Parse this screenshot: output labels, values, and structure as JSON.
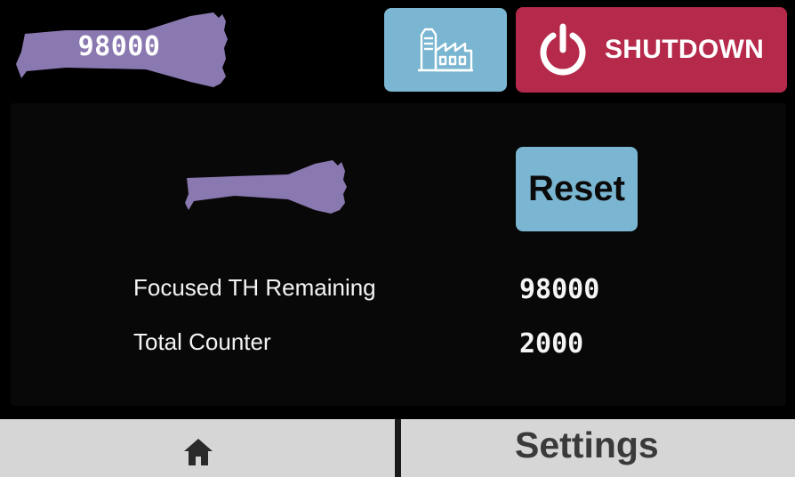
{
  "header": {
    "handpiece_counter": "98000",
    "factory_icon": "factory-icon",
    "shutdown_icon": "power-icon",
    "shutdown_label": "SHUTDOWN"
  },
  "main": {
    "handpiece_icon": "handpiece-icon",
    "reset_label": "Reset",
    "rows": [
      {
        "label": "Focused TH Remaining",
        "value": "98000"
      },
      {
        "label": "Total Counter",
        "value": "2000"
      }
    ]
  },
  "nav": {
    "home_icon": "home-icon",
    "settings_label": "Settings"
  },
  "colors": {
    "background": "#000000",
    "panel": "#080808",
    "handpiece": "#8a78b0",
    "button_blue": "#7ab6d1",
    "shutdown_red": "#b5294a",
    "nav_bar": "#d6d6d6"
  }
}
